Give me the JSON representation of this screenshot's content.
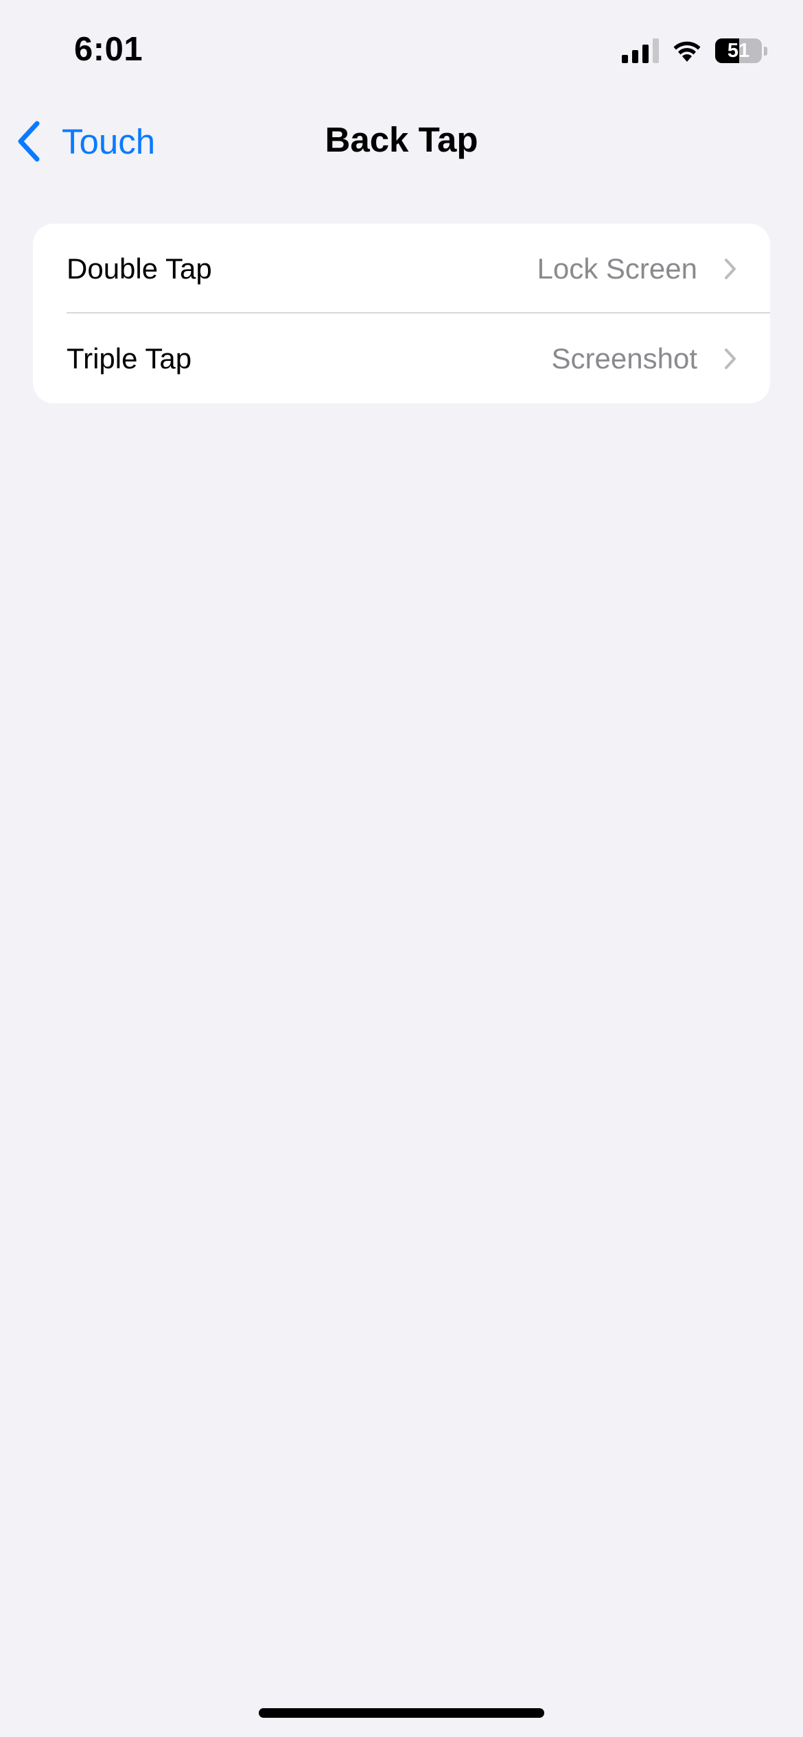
{
  "status_bar": {
    "time": "6:01",
    "battery_level": "51",
    "battery_fraction": 0.51,
    "signal_bars_active": 3,
    "signal_bars_total": 4,
    "icons": [
      "cellular-signal-icon",
      "wifi-icon",
      "battery-icon"
    ]
  },
  "nav": {
    "back_label": "Touch",
    "title": "Back Tap",
    "accent_color": "#0a7aff"
  },
  "settings": {
    "rows": [
      {
        "label": "Double Tap",
        "value": "Lock Screen"
      },
      {
        "label": "Triple Tap",
        "value": "Screenshot"
      }
    ]
  },
  "colors": {
    "background": "#f2f2f7",
    "card": "#ffffff",
    "secondary_text": "#8a8a8e"
  }
}
